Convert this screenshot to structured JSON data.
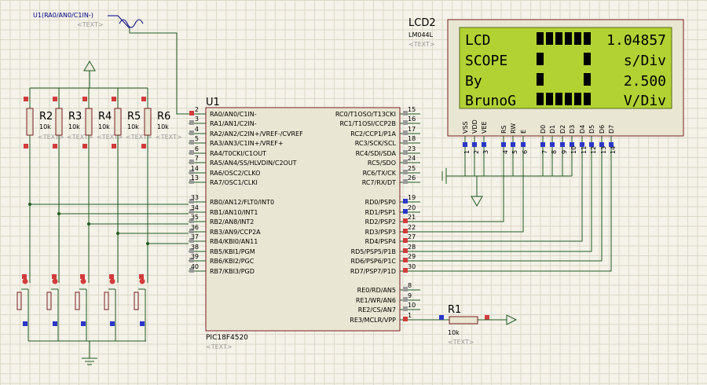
{
  "colors": {
    "wire": "#1f5a1f",
    "body": "#e9e6d3",
    "outline": "#7a1f1f",
    "label": "#000080",
    "gray": "#9a9a9a",
    "lcd": "#b2d234",
    "pinred": "#d23b3b",
    "pinblue": "#2b36c8"
  },
  "probe": {
    "label": "U1(RA0/AN0/C1IN-)",
    "text": "<TEXT>"
  },
  "resistors": [
    {
      "ref": "R2",
      "value": "10k",
      "text": "<TEXT>"
    },
    {
      "ref": "R3",
      "value": "10k",
      "text": "<TEXT>"
    },
    {
      "ref": "R4",
      "value": "10k",
      "text": "<TEXT>"
    },
    {
      "ref": "R5",
      "value": "10k",
      "text": "<TEXT>"
    },
    {
      "ref": "R6",
      "value": "10k",
      "text": "<TEXT>"
    }
  ],
  "r1": {
    "ref": "R1",
    "value": "10k",
    "text": "<TEXT>"
  },
  "mcu": {
    "ref": "U1",
    "part": "PIC18F4520",
    "text": "<TEXT>",
    "left_pins": [
      {
        "num": "2",
        "name": "RA0/AN0/C1IN-"
      },
      {
        "num": "3",
        "name": "RA1/AN1/C2IN-"
      },
      {
        "num": "4",
        "name": "RA2/AN2/C2IN+/VREF-/CVREF"
      },
      {
        "num": "5",
        "name": "RA3/AN3/C1IN+/VREF+"
      },
      {
        "num": "6",
        "name": "RA4/T0CKI/C1OUT"
      },
      {
        "num": "7",
        "name": "RA5/AN4/SS/HLVDIN/C2OUT"
      },
      {
        "num": "14",
        "name": "RA6/OSC2/CLKO"
      },
      {
        "num": "13",
        "name": "RA7/OSC1/CLKI"
      },
      {
        "num": "33",
        "name": "RB0/AN12/FLT0/INT0"
      },
      {
        "num": "34",
        "name": "RB1/AN10/INT1"
      },
      {
        "num": "35",
        "name": "RB2/AN8/INT2"
      },
      {
        "num": "36",
        "name": "RB3/AN9/CCP2A"
      },
      {
        "num": "37",
        "name": "RB4/KBI0/AN11"
      },
      {
        "num": "38",
        "name": "RB5/KBI1/PGM"
      },
      {
        "num": "39",
        "name": "RB6/KBI2/PGC"
      },
      {
        "num": "40",
        "name": "RB7/KBI3/PGD"
      }
    ],
    "right_pins": [
      {
        "num": "15",
        "name": "RC0/T1OSO/T13CKI"
      },
      {
        "num": "16",
        "name": "RC1/T1OSI/CCP2B"
      },
      {
        "num": "17",
        "name": "RC2/CCP1/P1A"
      },
      {
        "num": "18",
        "name": "RC3/SCK/SCL"
      },
      {
        "num": "23",
        "name": "RC4/SDI/SDA"
      },
      {
        "num": "24",
        "name": "RC5/SDO"
      },
      {
        "num": "25",
        "name": "RC6/TX/CK"
      },
      {
        "num": "26",
        "name": "RC7/RX/DT"
      },
      {
        "num": "19",
        "name": "RD0/PSP0"
      },
      {
        "num": "20",
        "name": "RD1/PSP1"
      },
      {
        "num": "21",
        "name": "RD2/PSP2"
      },
      {
        "num": "22",
        "name": "RD3/PSP3"
      },
      {
        "num": "27",
        "name": "RD4/PSP4"
      },
      {
        "num": "28",
        "name": "RD5/PSP5/P1B"
      },
      {
        "num": "29",
        "name": "RD6/PSP6/P1C"
      },
      {
        "num": "30",
        "name": "RD7/PSP7/P1D"
      },
      {
        "num": "8",
        "name": "RE0/RD/AN5"
      },
      {
        "num": "9",
        "name": "RE1/WR/AN6"
      },
      {
        "num": "10",
        "name": "RE2/CS/AN7"
      },
      {
        "num": "1",
        "name": "RE3/MCLR/VPP"
      }
    ]
  },
  "lcd": {
    "ref": "LCD2",
    "part": "LM044L",
    "text": "<TEXT>",
    "rows": [
      {
        "left": "LCD",
        "right": "1.04857",
        "bars": [
          1,
          1,
          1,
          1,
          1,
          1
        ]
      },
      {
        "left": "SCOPE",
        "right": "s/Div",
        "bars": [
          1,
          0,
          0,
          0,
          0,
          1
        ]
      },
      {
        "left": "By",
        "right": "2.500",
        "bars": [
          1,
          0,
          0,
          0,
          0,
          1
        ]
      },
      {
        "left": "BrunoG",
        "right": "V/Div",
        "bars": [
          1,
          1,
          1,
          1,
          1,
          1
        ]
      }
    ],
    "pin_names": [
      "VSS",
      "VDD",
      "VEE",
      "RS",
      "RW",
      "E",
      "D0",
      "D1",
      "D2",
      "D3",
      "D4",
      "D5",
      "D6",
      "D7"
    ],
    "pin_nums": [
      "1",
      "2",
      "3",
      "4",
      "5",
      "6",
      "7",
      "8",
      "9",
      "10",
      "11",
      "12",
      "13",
      "14"
    ]
  }
}
